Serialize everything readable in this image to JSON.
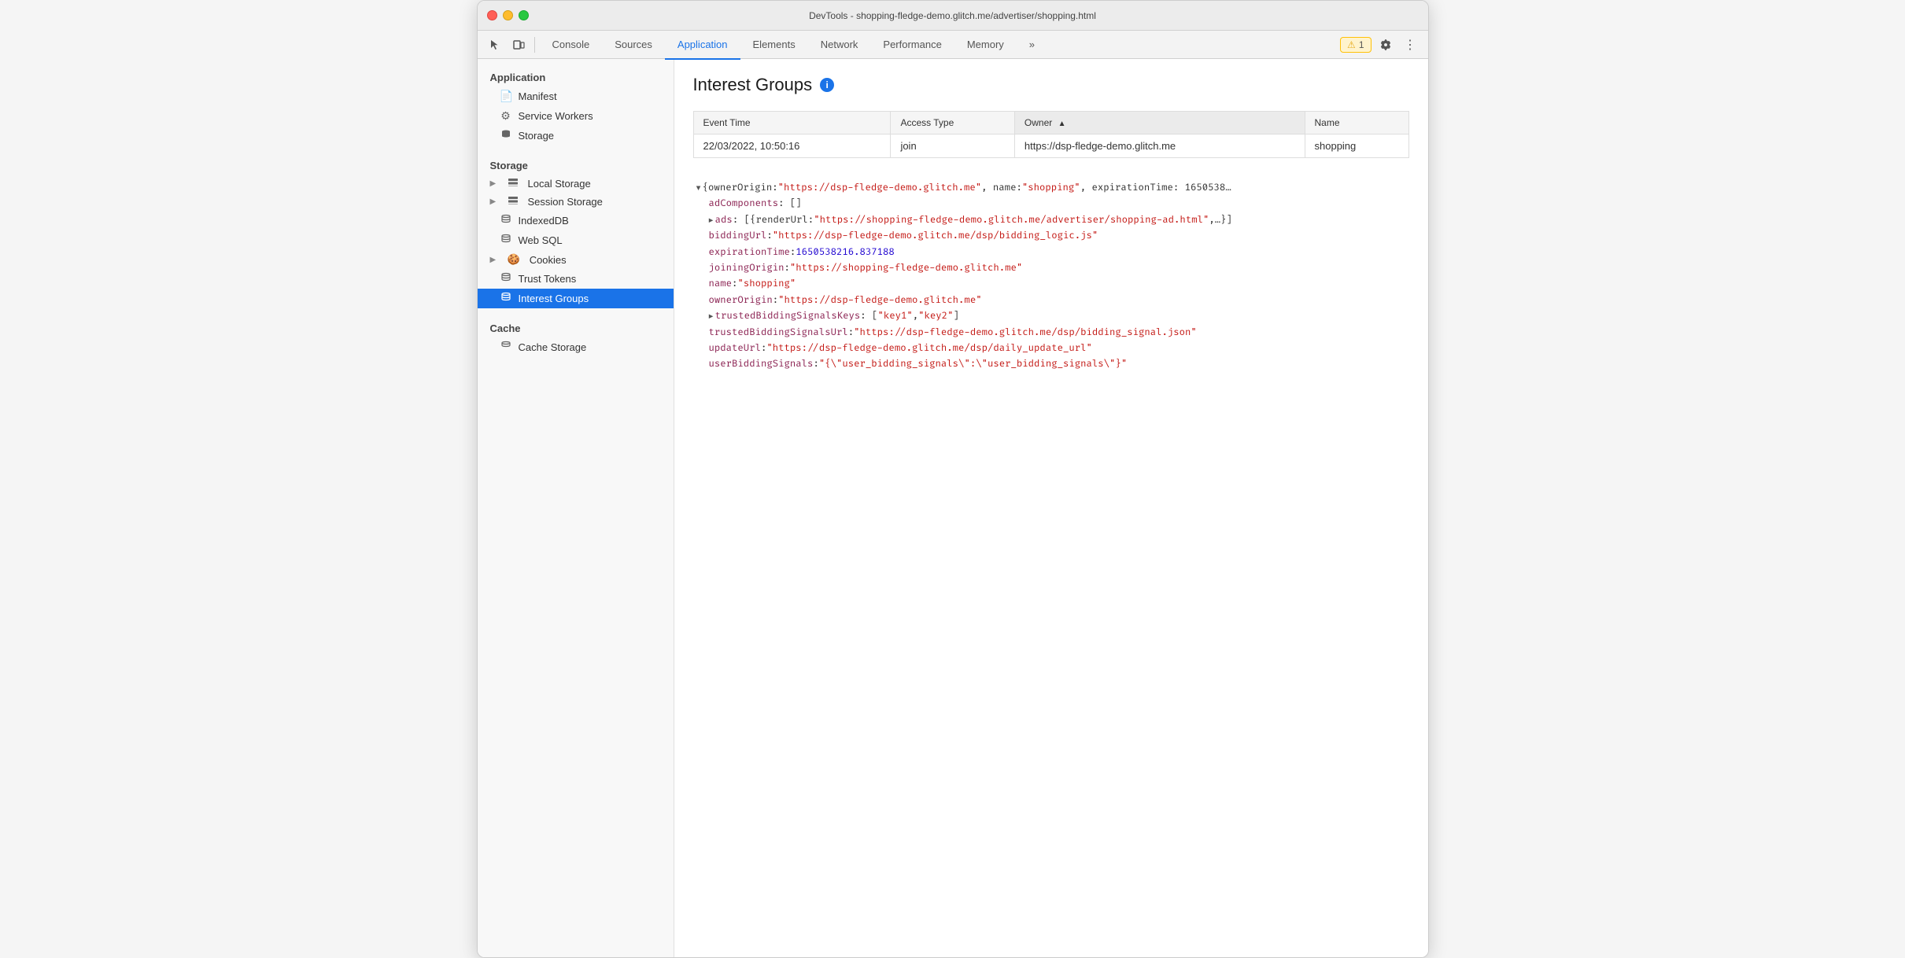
{
  "titlebar": {
    "title": "DevTools - shopping-fledge-demo.glitch.me/advertiser/shopping.html"
  },
  "toolbar": {
    "tabs": [
      {
        "id": "console",
        "label": "Console",
        "active": false
      },
      {
        "id": "sources",
        "label": "Sources",
        "active": false
      },
      {
        "id": "application",
        "label": "Application",
        "active": true
      },
      {
        "id": "elements",
        "label": "Elements",
        "active": false
      },
      {
        "id": "network",
        "label": "Network",
        "active": false
      },
      {
        "id": "performance",
        "label": "Performance",
        "active": false
      },
      {
        "id": "memory",
        "label": "Memory",
        "active": false
      }
    ],
    "more_label": "»",
    "warning_count": "1",
    "warning_icon": "⚠"
  },
  "sidebar": {
    "sections": [
      {
        "id": "application-section",
        "title": "Application",
        "items": [
          {
            "id": "manifest",
            "label": "Manifest",
            "icon": "📄",
            "active": false
          },
          {
            "id": "service-workers",
            "label": "Service Workers",
            "icon": "⚙",
            "active": false
          },
          {
            "id": "storage-item",
            "label": "Storage",
            "icon": "🗄",
            "active": false
          }
        ]
      },
      {
        "id": "storage-section",
        "title": "Storage",
        "items": [
          {
            "id": "local-storage",
            "label": "Local Storage",
            "icon": "▦",
            "expandable": true,
            "active": false
          },
          {
            "id": "session-storage",
            "label": "Session Storage",
            "icon": "▦",
            "expandable": true,
            "active": false
          },
          {
            "id": "indexeddb",
            "label": "IndexedDB",
            "icon": "🗄",
            "active": false
          },
          {
            "id": "web-sql",
            "label": "Web SQL",
            "icon": "🗄",
            "active": false
          },
          {
            "id": "cookies",
            "label": "Cookies",
            "icon": "🍪",
            "expandable": true,
            "active": false
          },
          {
            "id": "trust-tokens",
            "label": "Trust Tokens",
            "icon": "🗄",
            "active": false
          },
          {
            "id": "interest-groups",
            "label": "Interest Groups",
            "icon": "🗄",
            "active": true
          }
        ]
      },
      {
        "id": "cache-section",
        "title": "Cache",
        "items": [
          {
            "id": "cache-storage",
            "label": "Cache Storage",
            "icon": "🗄",
            "active": false
          }
        ]
      }
    ]
  },
  "content": {
    "page_title": "Interest Groups",
    "table": {
      "headers": [
        {
          "id": "event-time",
          "label": "Event Time",
          "sorted": false
        },
        {
          "id": "access-type",
          "label": "Access Type",
          "sorted": false
        },
        {
          "id": "owner",
          "label": "Owner",
          "sorted": true,
          "sort_dir": "▲"
        },
        {
          "id": "name",
          "label": "Name",
          "sorted": false
        }
      ],
      "rows": [
        {
          "event_time": "22/03/2022, 10:50:16",
          "access_type": "join",
          "owner": "https://dsp-fledge-demo.glitch.me",
          "name": "shopping"
        }
      ]
    },
    "json_viewer": [
      {
        "indent": 0,
        "expandable": true,
        "expanded": true,
        "content": "{ownerOrigin: \"https://dsp-fledge-demo.glitch.me\", name: \"shopping\", expirationTime: 1650538…",
        "key": null,
        "type": "root"
      },
      {
        "indent": 1,
        "expandable": false,
        "expanded": false,
        "content": null,
        "key": "adComponents",
        "value": "[]",
        "key_color": "purple",
        "value_color": "default"
      },
      {
        "indent": 1,
        "expandable": true,
        "expanded": false,
        "content": null,
        "key": "ads",
        "value": "[{renderUrl: \"https://shopping-fledge-demo.glitch.me/advertiser/shopping-ad.html\",…}]",
        "key_color": "purple",
        "value_color": "default"
      },
      {
        "indent": 1,
        "expandable": false,
        "content": null,
        "key": "biddingUrl",
        "value": "\"https://dsp-fledge-demo.glitch.me/dsp/bidding_logic.js\"",
        "key_color": "purple",
        "value_color": "red"
      },
      {
        "indent": 1,
        "expandable": false,
        "content": null,
        "key": "expirationTime",
        "value": "1650538216.837188",
        "key_color": "purple",
        "value_color": "blue"
      },
      {
        "indent": 1,
        "expandable": false,
        "content": null,
        "key": "joiningOrigin",
        "value": "\"https://shopping-fledge-demo.glitch.me\"",
        "key_color": "purple",
        "value_color": "red"
      },
      {
        "indent": 1,
        "expandable": false,
        "content": null,
        "key": "name",
        "value": "\"shopping\"",
        "key_color": "purple",
        "value_color": "red"
      },
      {
        "indent": 1,
        "expandable": false,
        "content": null,
        "key": "ownerOrigin",
        "value": "\"https://dsp-fledge-demo.glitch.me\"",
        "key_color": "purple",
        "value_color": "red"
      },
      {
        "indent": 1,
        "expandable": true,
        "expanded": false,
        "content": null,
        "key": "trustedBiddingSignalsKeys",
        "value": "[\"key1\", \"key2\"]",
        "key_color": "purple",
        "value_color": "default"
      },
      {
        "indent": 1,
        "expandable": false,
        "content": null,
        "key": "trustedBiddingSignalsUrl",
        "value": "\"https://dsp-fledge-demo.glitch.me/dsp/bidding_signal.json\"",
        "key_color": "purple",
        "value_color": "red"
      },
      {
        "indent": 1,
        "expandable": false,
        "content": null,
        "key": "updateUrl",
        "value": "\"https://dsp-fledge-demo.glitch.me/dsp/daily_update_url\"",
        "key_color": "purple",
        "value_color": "red"
      },
      {
        "indent": 1,
        "expandable": false,
        "content": null,
        "key": "userBiddingSignals",
        "value": "\"{\\\"user_bidding_signals\\\":\\\"user_bidding_signals\\\"}\"",
        "key_color": "purple",
        "value_color": "red"
      }
    ]
  }
}
